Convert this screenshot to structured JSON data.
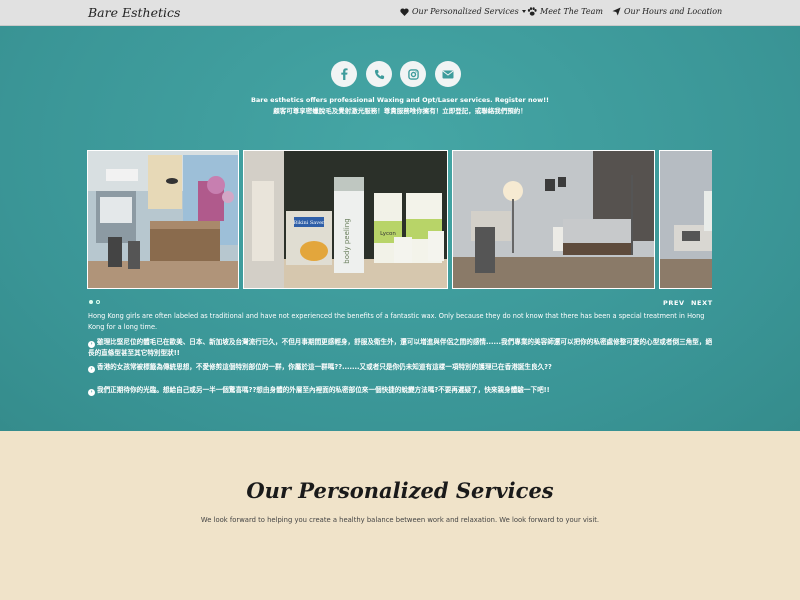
{
  "navbar": {
    "brand": "Bare Esthetics",
    "items": [
      {
        "label": "Our Personalized Services",
        "icon": "heart-icon",
        "dropdown": true
      },
      {
        "label": "Meet The Team",
        "icon": "paw-icon"
      },
      {
        "label": "Our Hours and Location",
        "icon": "paper-plane-icon"
      }
    ]
  },
  "hero": {
    "social_icons": [
      "facebook-icon",
      "phone-icon",
      "instagram-icon",
      "email-icon"
    ],
    "tagline_en": "Bare esthetics offers professional Waxing and Opt/Laser services. Register now!!",
    "tagline_zh": "顧客可尊享密蠟脫毛及覺射激光服務！尊貴服務唯你擁有！立即登記，或聯絡我們預約！",
    "carousel": {
      "prev_label": "PREV",
      "next_label": "NEXT",
      "slide_count": 2,
      "active_slide": 1,
      "product_labels": [
        "Bikini Saver",
        "body peeling",
        "Lycon"
      ]
    },
    "intro_en": "Hong Kong girls are often labeled as traditional and have not experienced the benefits of a fantastic wax. Only because they do not know that there has been a special treatment in Hong Kong for a long time.",
    "points_zh": [
      "雖理比堅尼位的體毛已在歐美、日本、新加坡及台灣流行已久，不但月事期間更感輕身，舒服及衛生外，還可以增進與伴侶之間的感情......我們專業的美容師還可以把你的私密處修整可愛的心型或者倒三角型，絕長的直條型甚至其它特別型狀!!",
      "香港的女孩常被標籤為傳統思想，不愛修剪這個特別部位的一群，你屬於這一群嗎??.......又或者只是你仍未知道有這樣一項特別的護理已在香港誕生良久??",
      "我們正期待你的光臨。想給自己或另一半一個驚喜嗎??想由身體的外層至內裡面的私密部位來一個快捷的蛻變方法嗎?不要再遲疑了，快來親身體驗一下吧!!"
    ]
  },
  "services": {
    "title": "Our Personalized Services",
    "subtitle": "We look forward to helping you create a healthy balance between work and relaxation. We look forward to your visit."
  },
  "colors": {
    "teal": "#3e9c9c",
    "beige": "#f0e3c9",
    "navbar": "#e1e1e1"
  }
}
